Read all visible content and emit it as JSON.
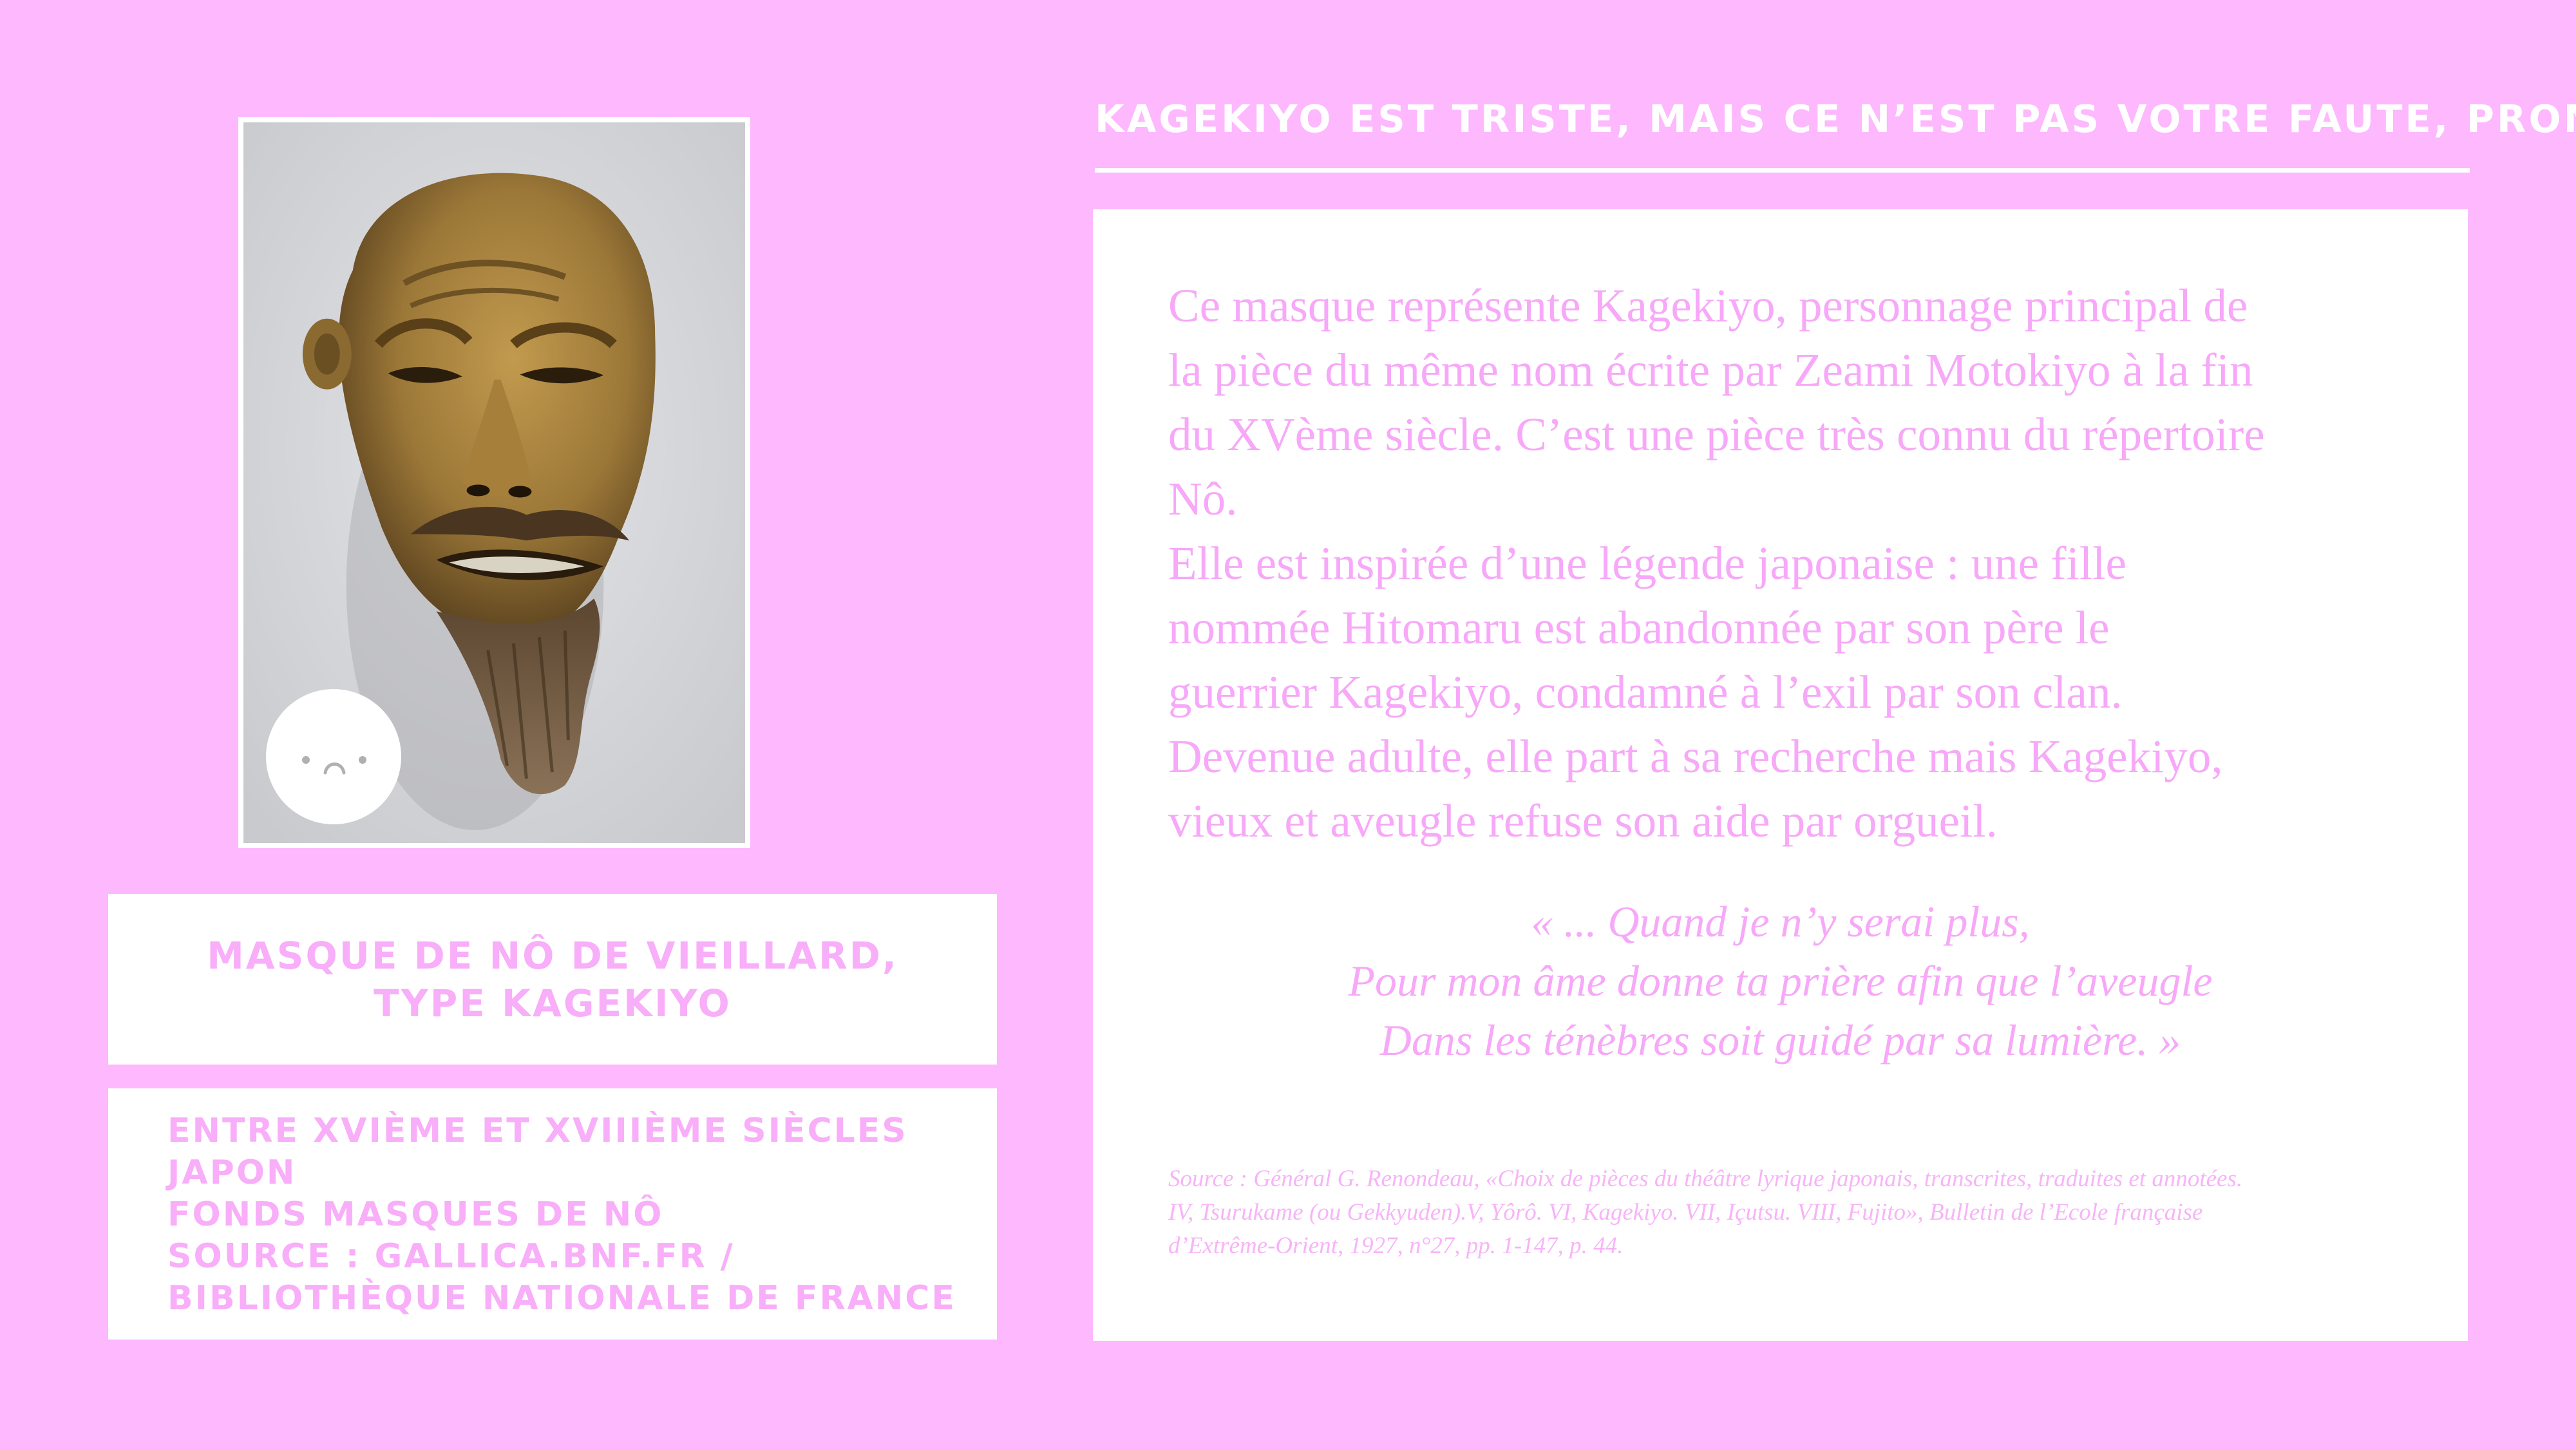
{
  "artwork": {
    "image_alt": "Nô mask of an old man, type Kagekiyo",
    "badge_icon": "sad-face-icon"
  },
  "caption": {
    "line1": "MASQUE DE NÔ DE VIEILLARD,",
    "line2": "TYPE KAGEKIYO"
  },
  "info": {
    "lines": [
      "ENTRE XVIÈME ET XVIIIÈME SIÈCLES",
      "JAPON",
      "FONDS MASQUES DE NÔ",
      "SOURCE : GALLICA.BNF.FR /",
      "BIBLIOTHÈQUE NATIONALE DE FRANCE"
    ]
  },
  "header": {
    "title": "KAGEKIYO EST TRISTE, MAIS CE N’EST PAS VOTRE FAUTE, PROMIS"
  },
  "description": {
    "lines": [
      "Ce masque représente Kagekiyo, personnage principal de",
      "la pièce du même nom écrite par Zeami Motokiyo à la fin",
      "du XVème siècle. C’est une pièce très connu du répertoire",
      "Nô.",
      "Elle est inspirée d’une légende japonaise : une fille",
      "nommée Hitomaru est abandonnée par son père le",
      "guerrier Kagekiyo, condamné à l’exil par son clan.",
      "Devenue adulte, elle part à sa recherche mais Kagekiyo,",
      "vieux et aveugle refuse son aide par orgueil."
    ]
  },
  "quote": {
    "lines": [
      "« ... Quand je n’y serai plus,",
      "Pour mon âme donne ta prière afin que l’aveugle",
      "Dans les ténèbres soit guidé par sa lumière. »"
    ]
  },
  "source": {
    "lines": [
      "Source : Général G. Renondeau, «Choix de pièces du théâtre lyrique japonais, transcrites, traduites et annotées.",
      "IV, Tsurukame (ou Gekkyuden).V, Yôrô. VI, Kagekiyo. VII, Içutsu. VIII, Fujito», Bulletin de l’Ecole française",
      "d’Extrême-Orient, 1927, n°27, pp. 1-147, p. 44."
    ]
  },
  "colors": {
    "background": "#fdb8fe",
    "panel": "#ffffff",
    "text_pink": "#f7a8f8"
  }
}
